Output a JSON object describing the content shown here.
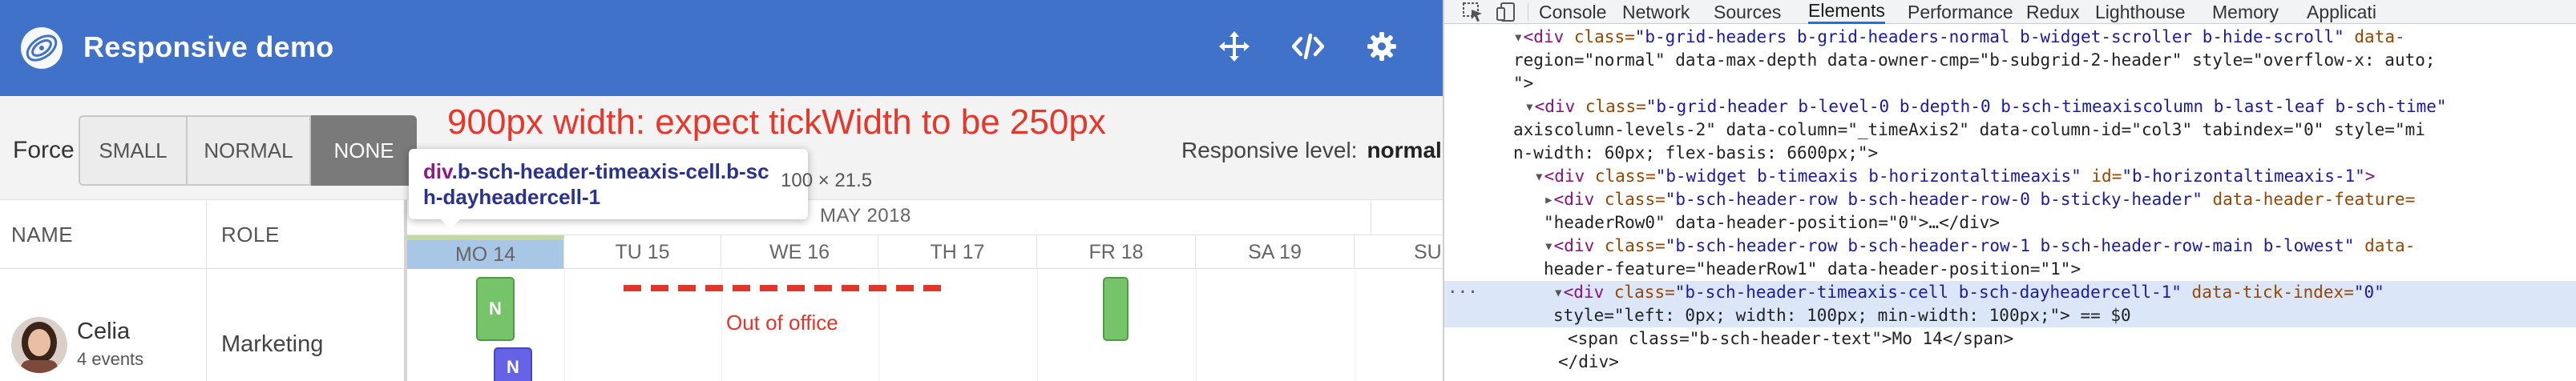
{
  "app": {
    "title": "Responsive demo",
    "header_icons": [
      "move-icon",
      "code-icon",
      "gear-icon"
    ],
    "brand_color": "#3f72c8"
  },
  "toolbar": {
    "force_label": "Force",
    "buttons": [
      "SMALL",
      "NORMAL",
      "NONE"
    ],
    "active_button": "NONE",
    "note": "900px width: expect tickWidth to be 250px",
    "responsive_label": "Responsive level:",
    "responsive_value": "normal"
  },
  "grid": {
    "columns": [
      "NAME",
      "ROLE"
    ],
    "week_label": "MAY 2018",
    "days": [
      "MO 14",
      "TU 15",
      "WE 16",
      "TH 17",
      "FR 18",
      "SA 19",
      "SU"
    ],
    "highlight_day": "MO 14",
    "resource": {
      "name": "Celia",
      "events": "4 events",
      "role": "Marketing"
    },
    "event_labels": [
      "N",
      "N"
    ],
    "ooo_label": "Out of office",
    "colors": {
      "event_green": "#76c469",
      "event_purple": "#6662e6",
      "ooo_red": "#e0362b"
    }
  },
  "tooltip": {
    "tag": "div",
    "selector": ".b-sch-header-timeaxis-cell.b-sch-dayheadercell-1",
    "size": "100 × 21.5"
  },
  "devtools": {
    "tabs": [
      "Console",
      "Network",
      "Sources",
      "Elements",
      "Performance",
      "Redux",
      "Lighthouse",
      "Memory",
      "Applicati"
    ],
    "active_tab": "Elements",
    "lines": [
      {
        "indent": 86,
        "tri": "▾",
        "tag": "div",
        "attrs": [
          [
            "class",
            "b-grid-headers b-grid-headers-normal b-widget-scroller b-hide-scroll"
          ],
          [
            "data-",
            ""
          ]
        ]
      },
      {
        "indent": 86,
        "text": "region=\"normal\" data-max-depth data-owner-cmp=\"b-subgrid-2-header\" style=\"overflow-x: auto;"
      },
      {
        "indent": 86,
        "text": "\">"
      },
      {
        "indent": 100,
        "tri": "▾",
        "tag": "div",
        "attrs": [
          [
            "class",
            "b-grid-header b-level-0 b-depth-0 b-sch-timeaxiscolumn b-last-leaf b-sch-time"
          ]
        ]
      },
      {
        "indent": 86,
        "text": "axiscolumn-levels-2\" data-column=\"_timeAxis2\" data-column-id=\"col3\" tabindex=\"0\" style=\"mi"
      },
      {
        "indent": 86,
        "text": "n-width: 60px; flex-basis: 6600px;\">"
      },
      {
        "indent": 112,
        "tri": "▾",
        "tag": "div",
        "attrs": [
          [
            "class",
            "b-widget b-timeaxis b-horizontaltimeaxis"
          ],
          [
            "id",
            "b-horizontaltimeaxis-1"
          ]
        ],
        "close": ">"
      },
      {
        "indent": 124,
        "tri": "▸",
        "tag": "div",
        "attrs": [
          [
            "class",
            "b-sch-header-row b-sch-header-row-0 b-sticky-header"
          ],
          [
            "data-header-feature",
            ""
          ]
        ]
      },
      {
        "indent": 124,
        "text": "\"headerRow0\" data-header-position=\"0\">…</div>"
      },
      {
        "indent": 124,
        "tri": "▾",
        "tag": "div",
        "attrs": [
          [
            "class",
            "b-sch-header-row b-sch-header-row-1 b-sch-header-row-main b-lowest"
          ],
          [
            "data-",
            ""
          ]
        ]
      },
      {
        "indent": 124,
        "text": "header-feature=\"headerRow1\" data-header-position=\"1\">"
      },
      {
        "indent": 136,
        "tri": "▾",
        "tag": "div",
        "attrs": [
          [
            "class",
            "b-sch-header-timeaxis-cell  b-sch-dayheadercell-1"
          ],
          [
            "data-tick-index",
            "0"
          ]
        ],
        "selected": true
      },
      {
        "indent": 136,
        "text": "style=\"left: 0px; width: 100px; min-width: 100px;\"> == $0",
        "selected": true
      },
      {
        "indent": 154,
        "text": "<span class=\"b-sch-header-text\">Mo 14</span>"
      },
      {
        "indent": 142,
        "text": "</div>"
      }
    ]
  }
}
